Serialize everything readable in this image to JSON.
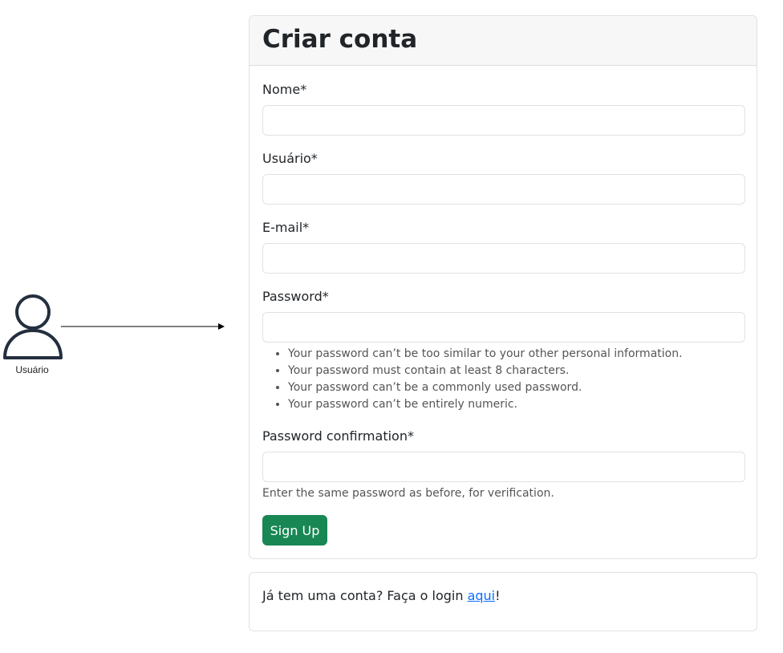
{
  "diagram": {
    "user_caption": "Usuário"
  },
  "form": {
    "title": "Criar conta",
    "fields": [
      {
        "label": "Nome*",
        "value": "",
        "placeholder": ""
      },
      {
        "label": "Usuário*",
        "value": "",
        "placeholder": ""
      },
      {
        "label": "E-mail*",
        "value": "",
        "placeholder": ""
      },
      {
        "label": "Password*",
        "value": "",
        "placeholder": ""
      },
      {
        "label": "Password confirmation*",
        "value": "",
        "placeholder": ""
      }
    ],
    "password_help": [
      "Your password can’t be too similar to your other personal information.",
      "Your password must contain at least 8 characters.",
      "Your password can’t be a commonly used password.",
      "Your password can’t be entirely numeric."
    ],
    "confirmation_help": "Enter the same password as before, for verification.",
    "submit_label": "Sign Up",
    "submit_color": "#198754"
  },
  "login": {
    "prefix": "Já tem uma conta? Faça o login ",
    "link_label": "aqui",
    "suffix": "!",
    "link_color": "#0d6efd"
  }
}
